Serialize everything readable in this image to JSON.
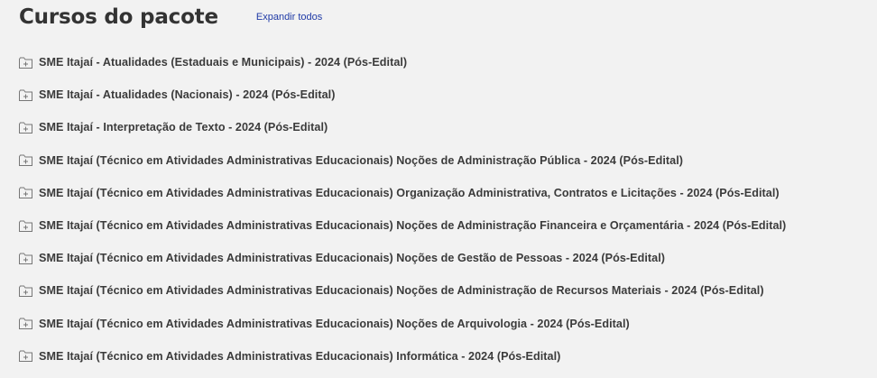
{
  "header": {
    "title": "Cursos do pacote",
    "expand_label": "Expandir todos"
  },
  "courses": [
    {
      "label": "SME Itajaí - Atualidades (Estaduais e Municipais) - 2024 (Pós-Edital)",
      "icon": "folder-plus-icon"
    },
    {
      "label": "SME Itajaí - Atualidades (Nacionais) - 2024 (Pós-Edital)",
      "icon": "folder-plus-icon"
    },
    {
      "label": "SME Itajaí - Interpretação de Texto - 2024 (Pós-Edital)",
      "icon": "folder-plus-icon"
    },
    {
      "label": "SME Itajaí (Técnico em Atividades Administrativas Educacionais) Noções de Administração Pública - 2024 (Pós-Edital)",
      "icon": "folder-plus-icon"
    },
    {
      "label": "SME Itajaí (Técnico em Atividades Administrativas Educacionais) Organização Administrativa, Contratos e Licitações - 2024 (Pós-Edital)",
      "icon": "folder-plus-icon"
    },
    {
      "label": "SME Itajaí (Técnico em Atividades Administrativas Educacionais) Noções de Administração Financeira e Orçamentária - 2024 (Pós-Edital)",
      "icon": "folder-plus-icon"
    },
    {
      "label": "SME Itajaí (Técnico em Atividades Administrativas Educacionais) Noções de Gestão de Pessoas - 2024 (Pós-Edital)",
      "icon": "folder-plus-icon"
    },
    {
      "label": "SME Itajaí (Técnico em Atividades Administrativas Educacionais) Noções de Administração de Recursos Materiais - 2024 (Pós-Edital)",
      "icon": "folder-plus-icon"
    },
    {
      "label": "SME Itajaí (Técnico em Atividades Administrativas Educacionais) Noções de Arquivologia - 2024 (Pós-Edital)",
      "icon": "folder-plus-icon"
    },
    {
      "label": "SME Itajaí (Técnico em Atividades Administrativas Educacionais) Informática - 2024 (Pós-Edital)",
      "icon": "folder-plus-icon"
    }
  ]
}
